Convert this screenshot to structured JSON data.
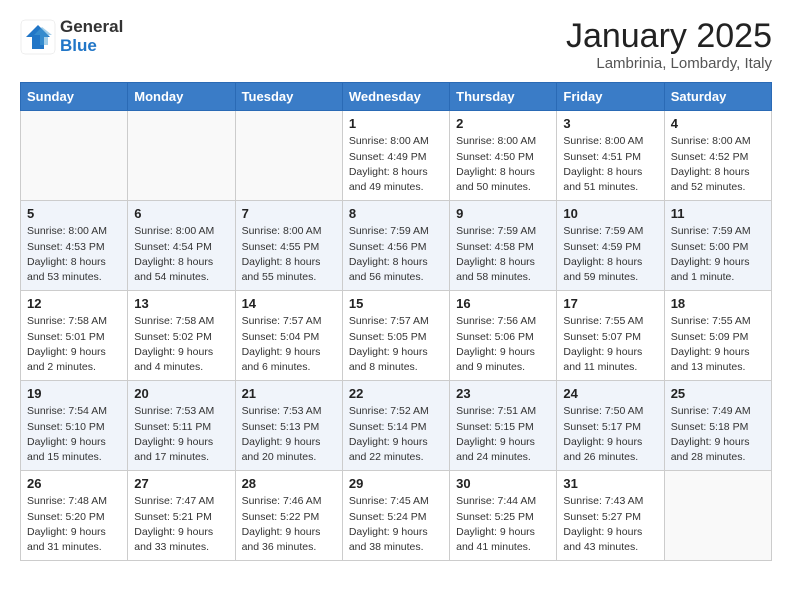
{
  "logo": {
    "general": "General",
    "blue": "Blue"
  },
  "title": "January 2025",
  "location": "Lambrinia, Lombardy, Italy",
  "weekdays": [
    "Sunday",
    "Monday",
    "Tuesday",
    "Wednesday",
    "Thursday",
    "Friday",
    "Saturday"
  ],
  "weeks": [
    [
      {
        "day": "",
        "info": ""
      },
      {
        "day": "",
        "info": ""
      },
      {
        "day": "",
        "info": ""
      },
      {
        "day": "1",
        "info": "Sunrise: 8:00 AM\nSunset: 4:49 PM\nDaylight: 8 hours\nand 49 minutes."
      },
      {
        "day": "2",
        "info": "Sunrise: 8:00 AM\nSunset: 4:50 PM\nDaylight: 8 hours\nand 50 minutes."
      },
      {
        "day": "3",
        "info": "Sunrise: 8:00 AM\nSunset: 4:51 PM\nDaylight: 8 hours\nand 51 minutes."
      },
      {
        "day": "4",
        "info": "Sunrise: 8:00 AM\nSunset: 4:52 PM\nDaylight: 8 hours\nand 52 minutes."
      }
    ],
    [
      {
        "day": "5",
        "info": "Sunrise: 8:00 AM\nSunset: 4:53 PM\nDaylight: 8 hours\nand 53 minutes."
      },
      {
        "day": "6",
        "info": "Sunrise: 8:00 AM\nSunset: 4:54 PM\nDaylight: 8 hours\nand 54 minutes."
      },
      {
        "day": "7",
        "info": "Sunrise: 8:00 AM\nSunset: 4:55 PM\nDaylight: 8 hours\nand 55 minutes."
      },
      {
        "day": "8",
        "info": "Sunrise: 7:59 AM\nSunset: 4:56 PM\nDaylight: 8 hours\nand 56 minutes."
      },
      {
        "day": "9",
        "info": "Sunrise: 7:59 AM\nSunset: 4:58 PM\nDaylight: 8 hours\nand 58 minutes."
      },
      {
        "day": "10",
        "info": "Sunrise: 7:59 AM\nSunset: 4:59 PM\nDaylight: 8 hours\nand 59 minutes."
      },
      {
        "day": "11",
        "info": "Sunrise: 7:59 AM\nSunset: 5:00 PM\nDaylight: 9 hours\nand 1 minute."
      }
    ],
    [
      {
        "day": "12",
        "info": "Sunrise: 7:58 AM\nSunset: 5:01 PM\nDaylight: 9 hours\nand 2 minutes."
      },
      {
        "day": "13",
        "info": "Sunrise: 7:58 AM\nSunset: 5:02 PM\nDaylight: 9 hours\nand 4 minutes."
      },
      {
        "day": "14",
        "info": "Sunrise: 7:57 AM\nSunset: 5:04 PM\nDaylight: 9 hours\nand 6 minutes."
      },
      {
        "day": "15",
        "info": "Sunrise: 7:57 AM\nSunset: 5:05 PM\nDaylight: 9 hours\nand 8 minutes."
      },
      {
        "day": "16",
        "info": "Sunrise: 7:56 AM\nSunset: 5:06 PM\nDaylight: 9 hours\nand 9 minutes."
      },
      {
        "day": "17",
        "info": "Sunrise: 7:55 AM\nSunset: 5:07 PM\nDaylight: 9 hours\nand 11 minutes."
      },
      {
        "day": "18",
        "info": "Sunrise: 7:55 AM\nSunset: 5:09 PM\nDaylight: 9 hours\nand 13 minutes."
      }
    ],
    [
      {
        "day": "19",
        "info": "Sunrise: 7:54 AM\nSunset: 5:10 PM\nDaylight: 9 hours\nand 15 minutes."
      },
      {
        "day": "20",
        "info": "Sunrise: 7:53 AM\nSunset: 5:11 PM\nDaylight: 9 hours\nand 17 minutes."
      },
      {
        "day": "21",
        "info": "Sunrise: 7:53 AM\nSunset: 5:13 PM\nDaylight: 9 hours\nand 20 minutes."
      },
      {
        "day": "22",
        "info": "Sunrise: 7:52 AM\nSunset: 5:14 PM\nDaylight: 9 hours\nand 22 minutes."
      },
      {
        "day": "23",
        "info": "Sunrise: 7:51 AM\nSunset: 5:15 PM\nDaylight: 9 hours\nand 24 minutes."
      },
      {
        "day": "24",
        "info": "Sunrise: 7:50 AM\nSunset: 5:17 PM\nDaylight: 9 hours\nand 26 minutes."
      },
      {
        "day": "25",
        "info": "Sunrise: 7:49 AM\nSunset: 5:18 PM\nDaylight: 9 hours\nand 28 minutes."
      }
    ],
    [
      {
        "day": "26",
        "info": "Sunrise: 7:48 AM\nSunset: 5:20 PM\nDaylight: 9 hours\nand 31 minutes."
      },
      {
        "day": "27",
        "info": "Sunrise: 7:47 AM\nSunset: 5:21 PM\nDaylight: 9 hours\nand 33 minutes."
      },
      {
        "day": "28",
        "info": "Sunrise: 7:46 AM\nSunset: 5:22 PM\nDaylight: 9 hours\nand 36 minutes."
      },
      {
        "day": "29",
        "info": "Sunrise: 7:45 AM\nSunset: 5:24 PM\nDaylight: 9 hours\nand 38 minutes."
      },
      {
        "day": "30",
        "info": "Sunrise: 7:44 AM\nSunset: 5:25 PM\nDaylight: 9 hours\nand 41 minutes."
      },
      {
        "day": "31",
        "info": "Sunrise: 7:43 AM\nSunset: 5:27 PM\nDaylight: 9 hours\nand 43 minutes."
      },
      {
        "day": "",
        "info": ""
      }
    ]
  ]
}
